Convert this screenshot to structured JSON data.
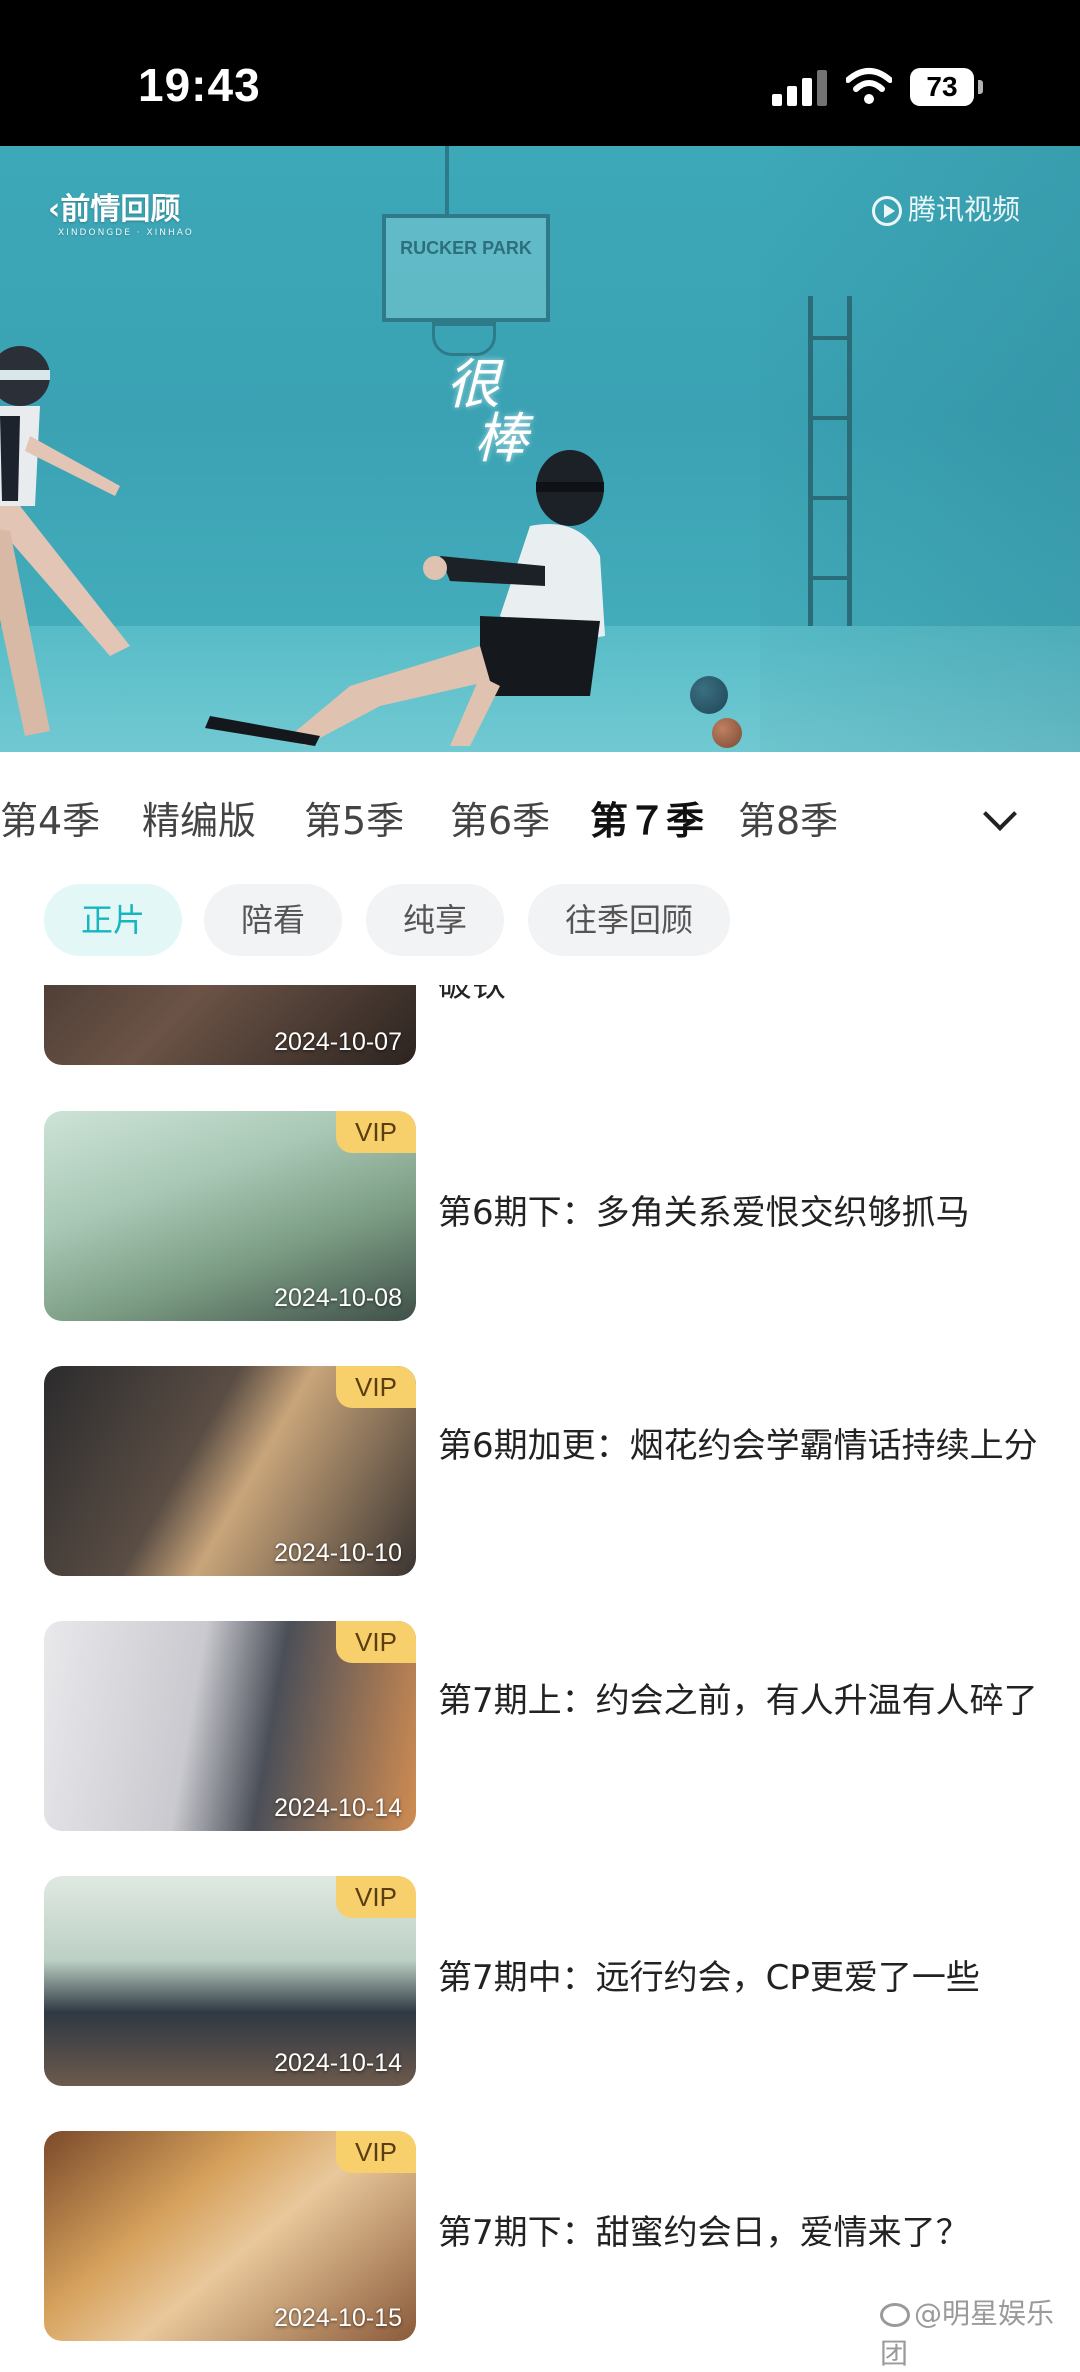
{
  "status_bar": {
    "time": "19:43",
    "battery": "73"
  },
  "video": {
    "recap_label": "前情回顾",
    "recap_small": "XINDONGDE · XINHAO",
    "brand": "腾讯视频",
    "backboard_text": "RUCKER PARK",
    "caption_line1": "很",
    "caption_line2": "棒"
  },
  "season_tabs": [
    {
      "label": "第4季",
      "active": false
    },
    {
      "label": "精编版",
      "active": false
    },
    {
      "label": "第5季",
      "active": false
    },
    {
      "label": "第6季",
      "active": false
    },
    {
      "label": "第７季",
      "active": true
    },
    {
      "label": "第8季",
      "active": false
    }
  ],
  "chips": [
    {
      "label": "正片",
      "active": true
    },
    {
      "label": "陪看",
      "active": false
    },
    {
      "label": "纯享",
      "active": false
    },
    {
      "label": "往季回顾",
      "active": false
    }
  ],
  "episodes": [
    {
      "date": "2024-10-07",
      "title": "破铁",
      "vip": false
    },
    {
      "date": "2024-10-08",
      "title": "第6期下：多角关系爱恨交织够抓马",
      "vip": true,
      "vip_label": "VIP"
    },
    {
      "date": "2024-10-10",
      "title": "第6期加更：烟花约会学霸情话持续上分",
      "vip": true,
      "vip_label": "VIP"
    },
    {
      "date": "2024-10-14",
      "title": "第7期上：约会之前，有人升温有人碎了",
      "vip": true,
      "vip_label": "VIP"
    },
    {
      "date": "2024-10-14",
      "title": "第7期中：远行约会，CP更爱了一些",
      "vip": true,
      "vip_label": "VIP"
    },
    {
      "date": "2024-10-15",
      "title": "第7期下：甜蜜约会日，爱情来了？",
      "vip": true,
      "vip_label": "VIP"
    }
  ],
  "watermark": "@明星娱乐团",
  "colors": {
    "accent": "#17b6bf",
    "vip": "#f7cf6b",
    "pool": "#3da8b8"
  }
}
